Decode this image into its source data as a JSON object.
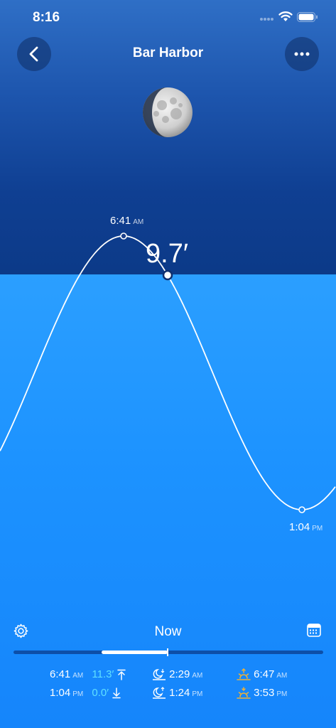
{
  "status": {
    "time": "8:16"
  },
  "header": {
    "title": "Bar Harbor"
  },
  "chart": {
    "high_time": "6:41",
    "high_ampm": "AM",
    "low_time": "1:04",
    "low_ampm": "PM",
    "current_height": "9.7′"
  },
  "controls": {
    "now_label": "Now"
  },
  "tides": [
    {
      "time": "6:41",
      "ampm": "AM",
      "height": "11.3′",
      "direction": "up-arrow-icon"
    },
    {
      "time": "1:04",
      "ampm": "PM",
      "height": "0.0′",
      "direction": "down-arrow-icon"
    }
  ],
  "moon_times": [
    {
      "time": "2:29",
      "ampm": "AM",
      "icon": "moonset-icon"
    },
    {
      "time": "1:24",
      "ampm": "PM",
      "icon": "moonrise-icon"
    }
  ],
  "sun_times": [
    {
      "time": "6:47",
      "ampm": "AM",
      "icon": "sunrise-icon"
    },
    {
      "time": "3:53",
      "ampm": "PM",
      "icon": "sunset-icon"
    }
  ],
  "colors": {
    "sun_icon": "#f2b233",
    "height_accent": "#5fe0ff"
  }
}
